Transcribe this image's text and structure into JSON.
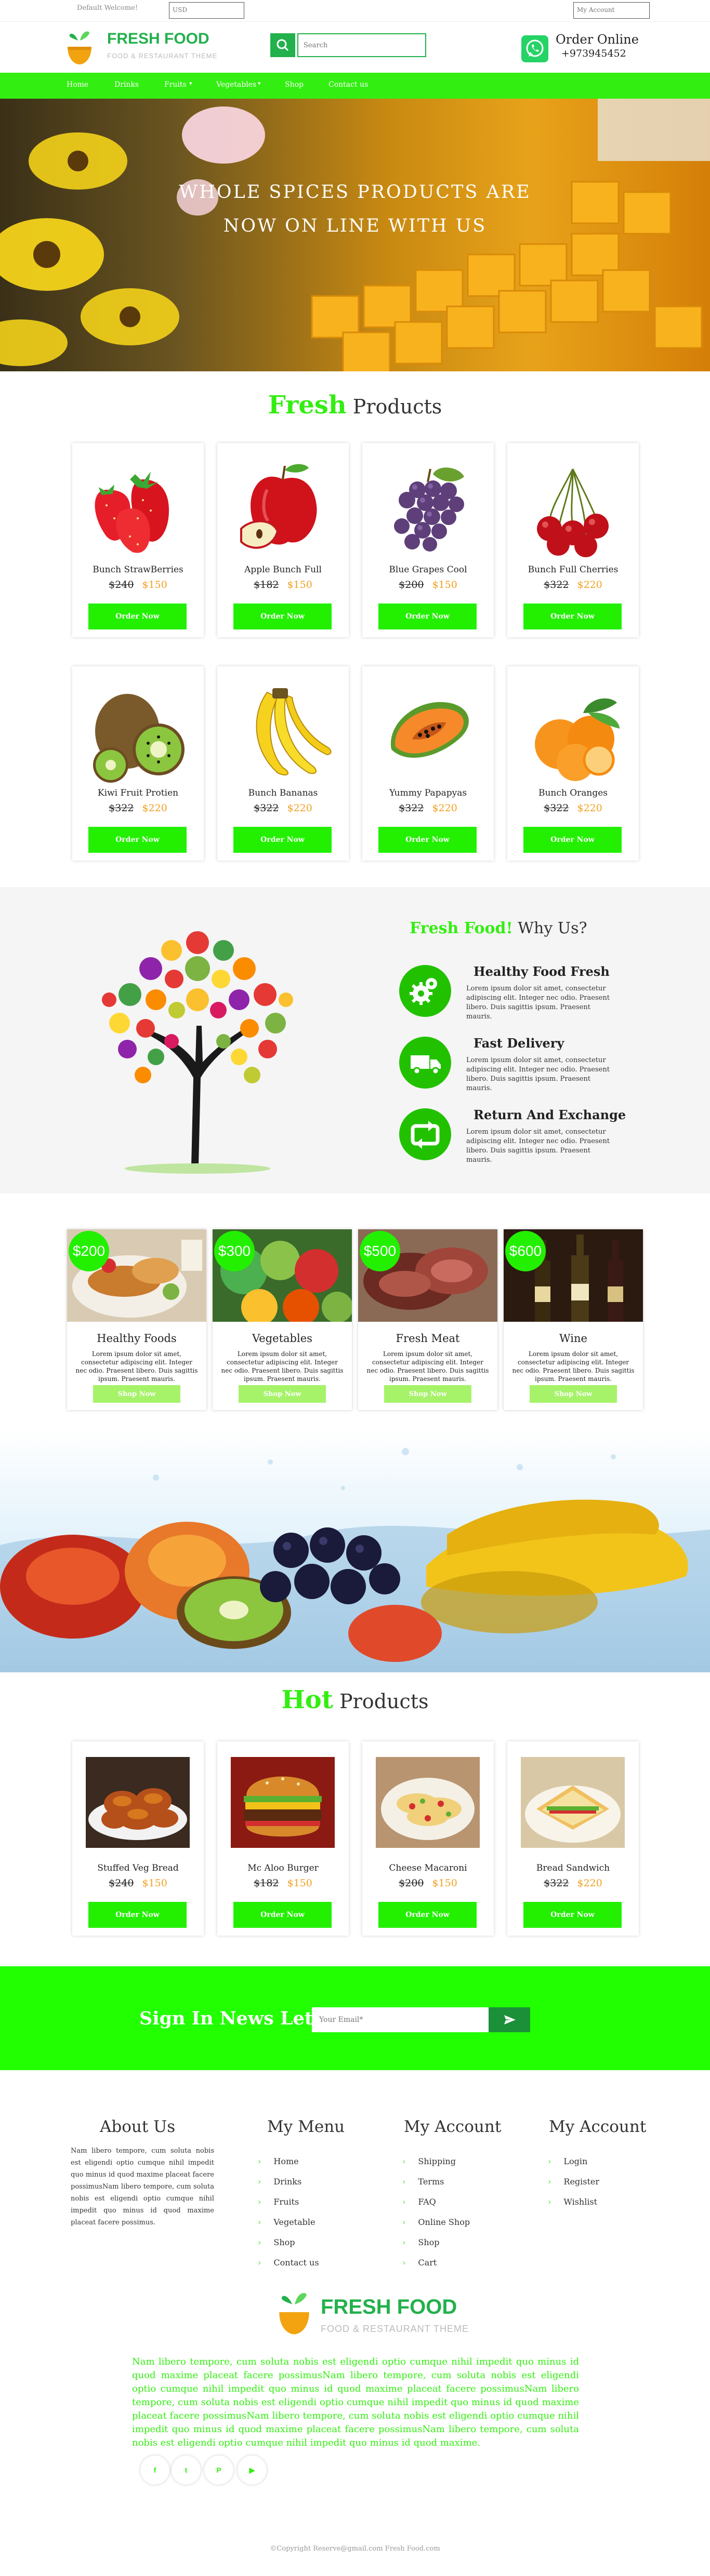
{
  "topbar": {
    "welcome": "Default Welcome!",
    "currency": "USD",
    "account": "My Account"
  },
  "header": {
    "logo_title": "FRESH FOOD",
    "logo_sub": "FOOD & RESTAURANT THEME",
    "search_placeholder": "Search",
    "order_label": "Order Online",
    "phone": "+973945452"
  },
  "nav": [
    "Home",
    "Drinks",
    "Fruits",
    "Vegetables",
    "Shop",
    "Contact us"
  ],
  "hero": {
    "line1": "WHOLE SPICES PRODUCTS ARE",
    "line2": "NOW ON LINE WITH US"
  },
  "fresh": {
    "hl": "Fresh",
    "rest": "Products"
  },
  "products": [
    {
      "name": "Bunch StrawBerries",
      "old": "$240",
      "new": "$150",
      "btn": "Order Now"
    },
    {
      "name": "Apple Bunch Full",
      "old": "$182",
      "new": "$150",
      "btn": "Order Now"
    },
    {
      "name": "Blue Grapes Cool",
      "old": "$200",
      "new": "$150",
      "btn": "Order Now"
    },
    {
      "name": "Bunch Full Cherries",
      "old": "$322",
      "new": "$220",
      "btn": "Order Now"
    },
    {
      "name": "Kiwi Fruit Protien",
      "old": "$322",
      "new": "$220",
      "btn": "Order Now"
    },
    {
      "name": "Bunch Bananas",
      "old": "$322",
      "new": "$220",
      "btn": "Order Now"
    },
    {
      "name": "Yummy Papapyas",
      "old": "$322",
      "new": "$220",
      "btn": "Order Now"
    },
    {
      "name": "Bunch Oranges",
      "old": "$322",
      "new": "$220",
      "btn": "Order Now"
    }
  ],
  "why": {
    "hl": "Fresh Food!",
    "rest": " Why Us?",
    "features": [
      {
        "title": "Healthy Food Fresh",
        "text": "Lorem ipsum dolor sit amet, consectetur adipiscing elit. Integer nec odio. Praesent libero. Duis sagittis ipsum. Praesent mauris."
      },
      {
        "title": "Fast Delivery",
        "text": "Lorem ipsum dolor sit amet, consectetur adipiscing elit. Integer nec odio. Praesent libero. Duis sagittis ipsum. Praesent mauris."
      },
      {
        "title": "Return And Exchange",
        "text": "Lorem ipsum dolor sit amet, consectetur adipiscing elit. Integer nec odio. Praesent libero. Duis sagittis ipsum. Praesent mauris."
      }
    ]
  },
  "categories": [
    {
      "price": "$200",
      "title": "Healthy Foods",
      "text": "Lorem ipsum dolor sit amet, consectetur adipiscing elit. Integer nec odio. Praesent libero. Duis sagittis ipsum. Praesent mauris.",
      "btn": "Shop Now"
    },
    {
      "price": "$300",
      "title": "Vegetables",
      "text": "Lorem ipsum dolor sit amet, consectetur adipiscing elit. Integer nec odio. Praesent libero. Duis sagittis ipsum. Praesent mauris.",
      "btn": "Shop Now"
    },
    {
      "price": "$500",
      "title": "Fresh Meat",
      "text": "Lorem ipsum dolor sit amet, consectetur adipiscing elit. Integer nec odio. Praesent libero. Duis sagittis ipsum. Praesent mauris.",
      "btn": "Shop Now"
    },
    {
      "price": "$600",
      "title": "Wine",
      "text": "Lorem ipsum dolor sit amet, consectetur adipiscing elit. Integer nec odio. Praesent libero. Duis sagittis ipsum. Praesent mauris.",
      "btn": "Shop Now"
    }
  ],
  "hot": {
    "hl": "Hot",
    "rest": "Products"
  },
  "hot_products": [
    {
      "name": "Stuffed Veg Bread",
      "old": "$240",
      "new": "$150",
      "btn": "Order Now"
    },
    {
      "name": "Mc Aloo Burger",
      "old": "$182",
      "new": "$150",
      "btn": "Order Now"
    },
    {
      "name": "Cheese Macaroni",
      "old": "$200",
      "new": "$150",
      "btn": "Order Now"
    },
    {
      "name": "Bread Sandwich",
      "old": "$322",
      "new": "$220",
      "btn": "Order Now"
    }
  ],
  "newsletter": {
    "title": "Sign In News Letter",
    "placeholder": "Your Email*"
  },
  "footer": {
    "about_title": "About Us",
    "about_text": "Nam libero tempore, cum soluta nobis est eligendi optio cumque nihil impedit quo minus id quod maxime placeat facere possimusNam libero tempore, cum soluta nobis est eligendi optio cumque nihil impedit quo minus id quod maxime placeat facere possimus.",
    "menu_title": "My Menu",
    "menu": [
      "Home",
      "Drinks",
      "Fruits",
      "Vegetable",
      "Shop",
      "Contact us"
    ],
    "account_title": "My Account",
    "account": [
      "Shipping",
      "Terms",
      "FAQ",
      "Online Shop",
      "Shop",
      "Cart"
    ],
    "account2_title": "My Account",
    "account2": [
      "Login",
      "Register",
      "Wishlist"
    ],
    "logo_title": "FRESH FOOD",
    "logo_sub": "FOOD & RESTAURANT THEME",
    "para": "Nam libero tempore, cum soluta nobis est eligendi optio cumque nihil impedit quo minus id quod maxime placeat facere possimusNam libero tempore, cum soluta nobis est eligendi optio cumque nihil impedit quo minus id quod maxime placeat facere possimusNam libero tempore, cum soluta nobis est eligendi optio cumque nihil impedit quo minus id quod maxime placeat facere possimusNam libero tempore, cum soluta nobis est eligendi optio cumque nihil impedit quo minus id quod maxime placeat facere possimusNam libero tempore, cum soluta nobis est eligendi optio cumque nihil impedit quo minus id quod maxime.",
    "social": [
      {
        "label": "f",
        "icon": "facebook-icon"
      },
      {
        "label": "t",
        "icon": "twitter-icon"
      },
      {
        "label": "P",
        "icon": "pinterest-icon"
      },
      {
        "label": "▶",
        "icon": "youtube-icon"
      }
    ],
    "copyright": "©Copyright Reserve@gmail.com Fresh Food.com"
  }
}
